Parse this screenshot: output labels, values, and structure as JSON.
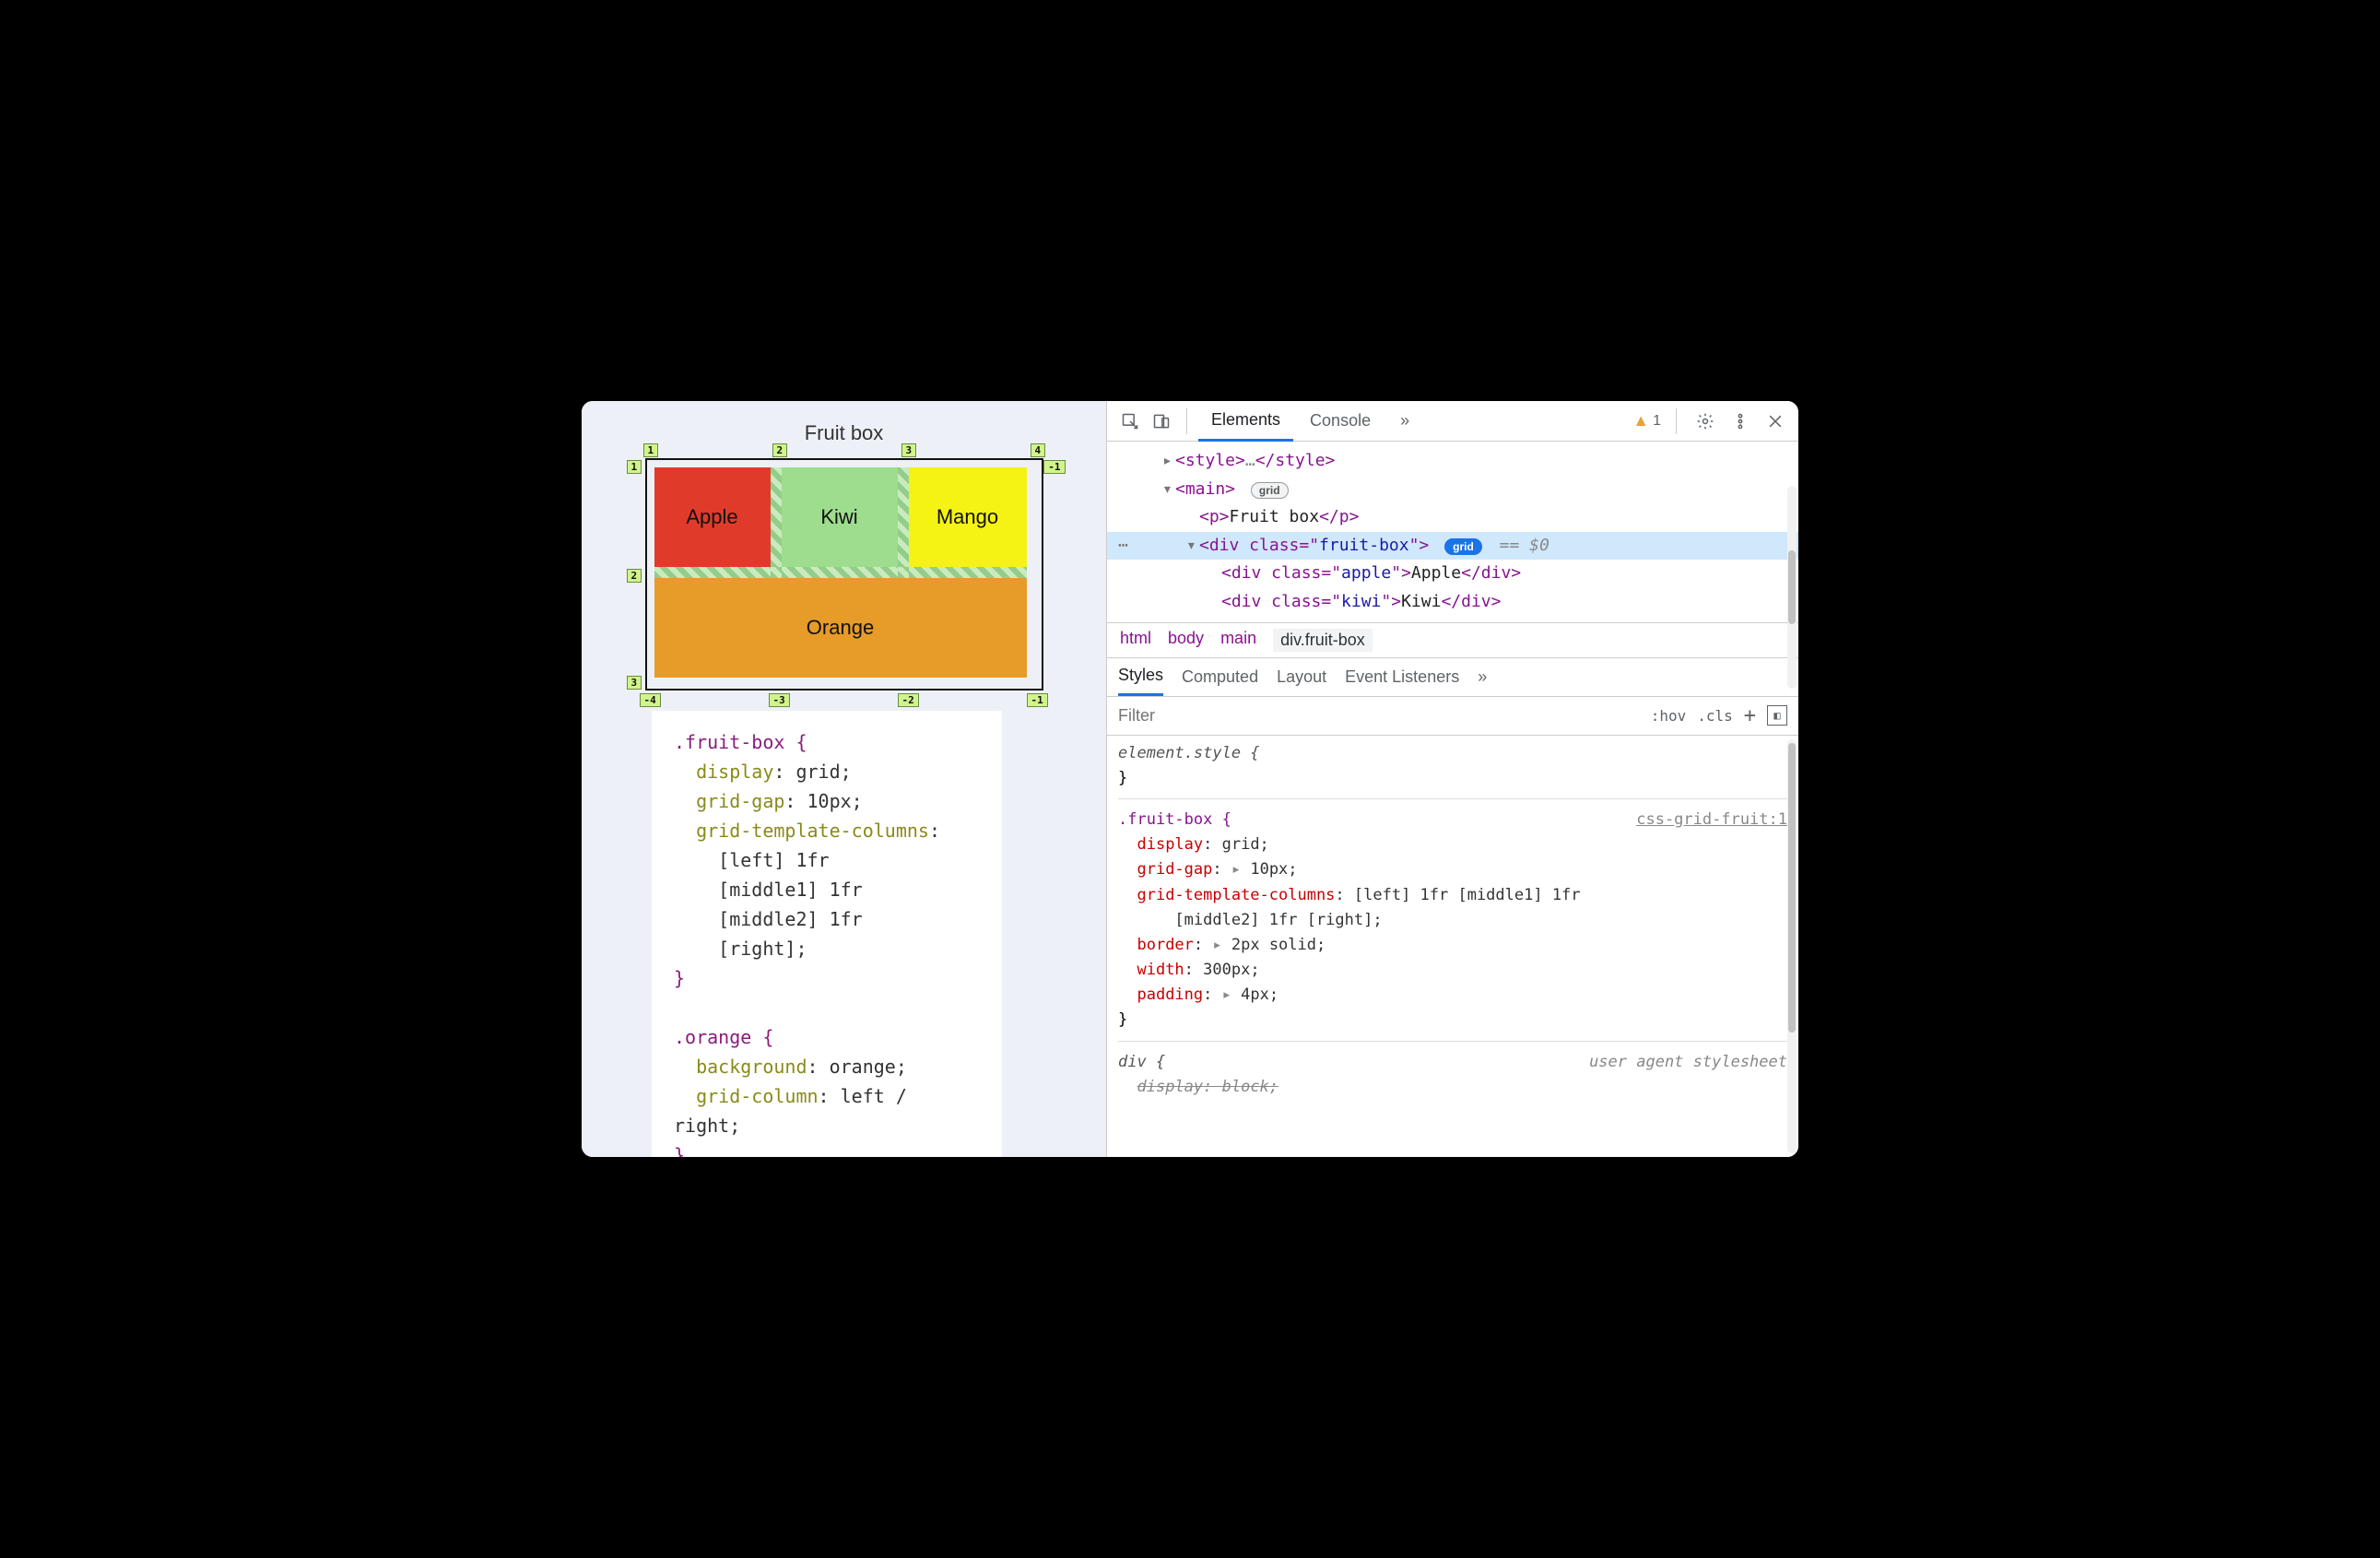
{
  "page": {
    "title": "Fruit box",
    "grid": {
      "topTicks": [
        "1",
        "2",
        "3",
        "4"
      ],
      "leftTicks": [
        "1",
        "2"
      ],
      "rightTopTick": "-1",
      "leftBottomTick": "3",
      "bottomTicks": [
        "-4",
        "-3",
        "-2",
        "-1"
      ],
      "cells": {
        "apple": "Apple",
        "kiwi": "Kiwi",
        "mango": "Mango",
        "orange": "Orange"
      }
    },
    "code": {
      "l1": ".fruit-box {",
      "l2p": "display",
      "l2v": ": grid;",
      "l3p": "grid-gap",
      "l3v": ": 10px;",
      "l4p": "grid-template-columns",
      "l4v": ":",
      "l5": "[left] 1fr",
      "l6": "[middle1] 1fr",
      "l7": "[middle2] 1fr",
      "l8": "[right];",
      "l9": "}",
      "l10": ".orange {",
      "l11p": "background",
      "l11v": ": orange;",
      "l12p": "grid-column",
      "l12v": ": left / right;",
      "l13": "}"
    }
  },
  "devtools": {
    "tabs": {
      "elements": "Elements",
      "console": "Console"
    },
    "more": "»",
    "warnCount": "1",
    "dom": {
      "r1a": "<style>",
      "r1b": "…",
      "r1c": "</style>",
      "r2": "<main>",
      "r2pill": "grid",
      "r3a": "<p>",
      "r3b": "Fruit box",
      "r3c": "</p>",
      "r4a": "<div class=\"",
      "r4b": "fruit-box",
      "r4c": "\">",
      "r4pill": "grid",
      "r4eq": "== $0",
      "r5a": "<div class=\"",
      "r5b": "apple",
      "r5c": "\">",
      "r5d": "Apple",
      "r5e": "</div>",
      "r6a": "<div class=\"",
      "r6b": "kiwi",
      "r6c": "\">",
      "r6d": "Kiwi",
      "r6e": "</div>"
    },
    "crumbs": {
      "html": "html",
      "body": "body",
      "main": "main",
      "selected": "div.fruit-box"
    },
    "stylesTabs": {
      "styles": "Styles",
      "computed": "Computed",
      "layout": "Layout",
      "events": "Event Listeners",
      "more": "»"
    },
    "filter": {
      "placeholder": "Filter",
      "hov": ":hov",
      "cls": ".cls",
      "plus": "+"
    },
    "rules": {
      "elStyleOpen": "element.style {",
      "close": "}",
      "src1": "css-grid-fruit:1",
      "sel1": ".fruit-box {",
      "p1": "display",
      "v1": ": grid;",
      "p2": "grid-gap",
      "v2": "10px;",
      "p3": "grid-template-columns",
      "v3": ": [left] 1fr [middle1] 1fr",
      "v3b": "[middle2] 1fr [right];",
      "p4": "border",
      "v4": "2px solid;",
      "p5": "width",
      "v5": ": 300px;",
      "p6": "padding",
      "v6": "4px;",
      "sel2": "div {",
      "src2": "user agent stylesheet",
      "p7": "display",
      "v7": ": block;"
    }
  }
}
